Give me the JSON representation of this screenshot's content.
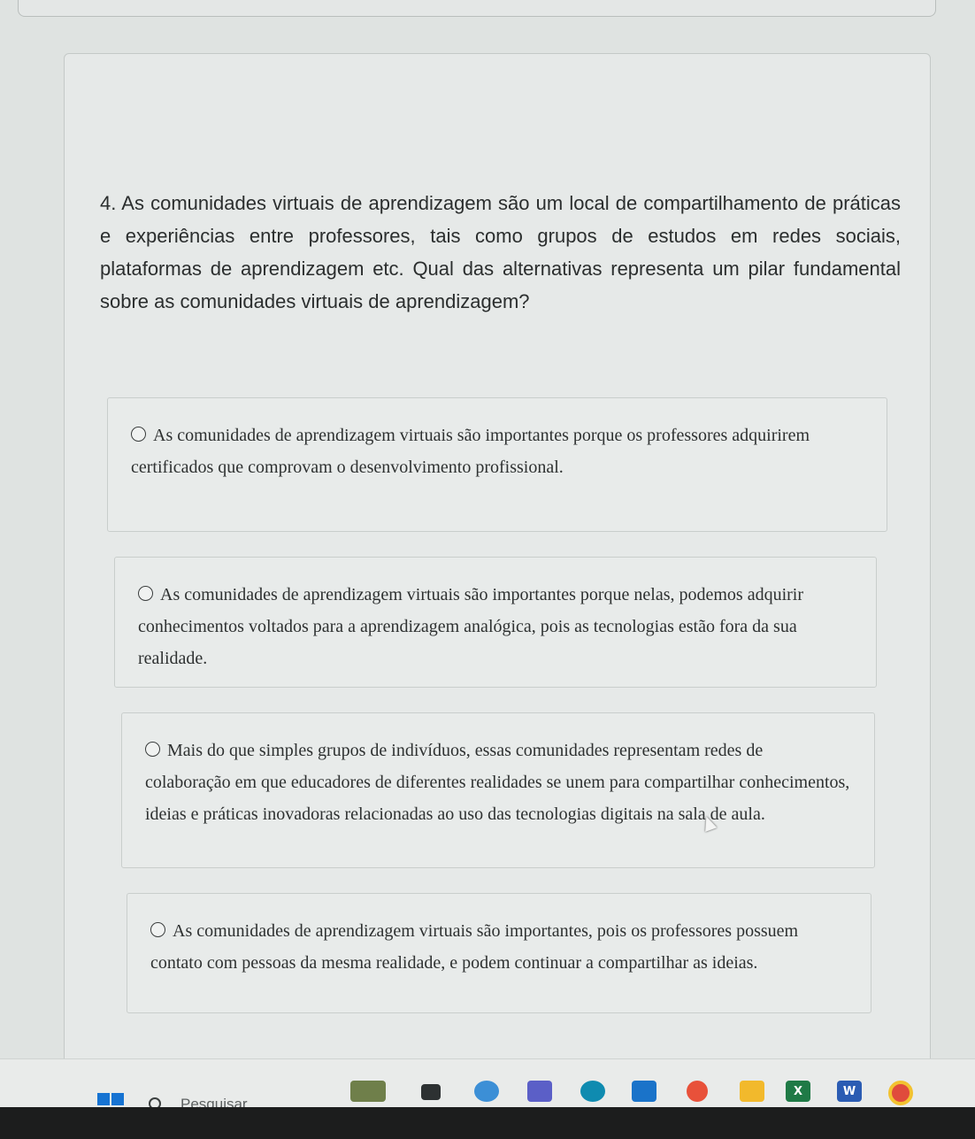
{
  "question": {
    "text": "4. As comunidades virtuais de aprendizagem são um local de compartilhamento de práticas e experiências entre professores, tais como grupos de estudos em redes sociais, plataformas de aprendizagem etc. Qual das alternativas representa um pilar fundamental sobre as comunidades virtuais de aprendizagem?"
  },
  "options": [
    {
      "text": "As comunidades de aprendizagem virtuais são importantes porque os professores adquirirem certificados que comprovam o desenvolvimento profissional."
    },
    {
      "text": "As comunidades de aprendizagem virtuais são importantes porque nelas, podemos adquirir conhecimentos voltados para a aprendizagem analógica, pois as tecnologias estão fora da sua realidade."
    },
    {
      "text": "Mais do que simples grupos de indivíduos, essas comunidades representam redes de colaboração em que educadores de diferentes realidades se unem para compartilhar conhecimentos, ideias e práticas inovadoras relacionadas ao uso das tecnologias digitais na sala de aula."
    },
    {
      "text": "As comunidades de aprendizagem virtuais são importantes, pois os professores possuem contato com pessoas da mesma realidade, e podem continuar a compartilhar as ideias."
    }
  ],
  "taskbar": {
    "search_placeholder": "Pesquisar",
    "excel_letter": "X",
    "word_letter": "W",
    "icons": [
      "windows-start-icon",
      "search-icon",
      "widgets-icon",
      "task-view-icon",
      "copilot-icon",
      "teams-icon",
      "edge-icon",
      "store-icon",
      "firefox-icon",
      "file-explorer-icon",
      "excel-icon",
      "word-icon",
      "chrome-icon"
    ],
    "colors": {
      "start": "#1673d2",
      "teams": "#5b5fc7",
      "edge": "#0f8bb0",
      "store": "#1a73c9",
      "firefox": "#e8513a",
      "explorer": "#f2b92c",
      "excel": "#1f7a46",
      "word": "#2b5cb3",
      "chrome": "#e04b3c"
    }
  }
}
